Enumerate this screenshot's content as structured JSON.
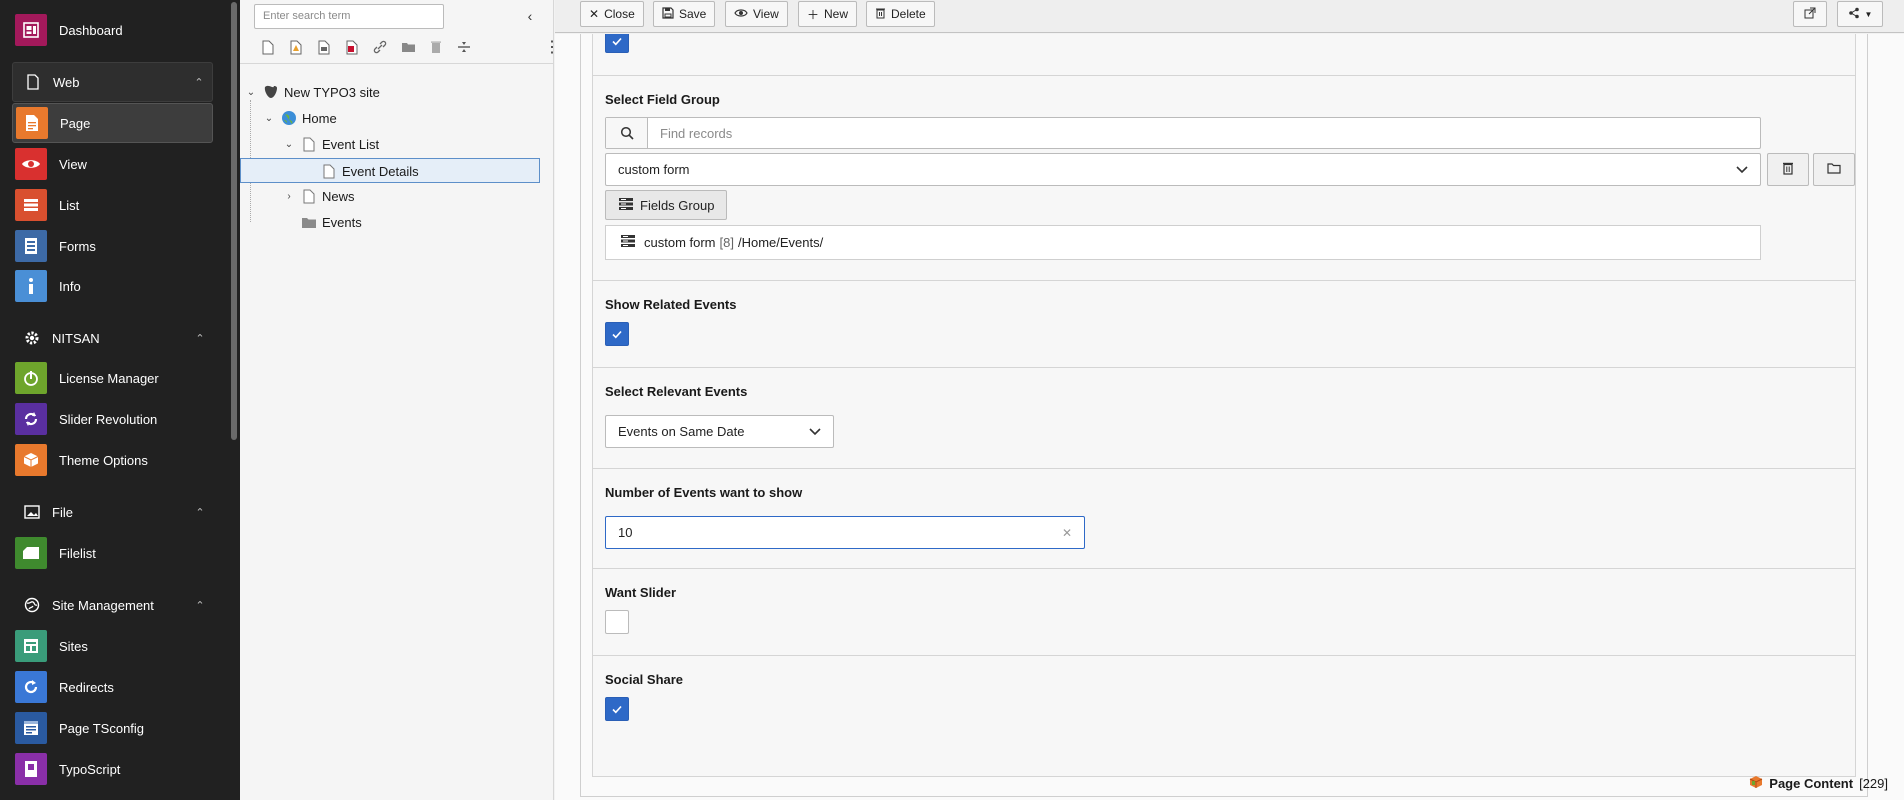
{
  "modules": {
    "dashboard": "Dashboard",
    "web": "Web",
    "page": "Page",
    "view": "View",
    "list": "List",
    "forms": "Forms",
    "info": "Info",
    "nitsan": "NITSAN",
    "license_manager": "License Manager",
    "slider_revolution": "Slider Revolution",
    "theme_options": "Theme Options",
    "file": "File",
    "filelist": "Filelist",
    "site_management": "Site Management",
    "sites": "Sites",
    "redirects": "Redirects",
    "page_tsconfig": "Page TSconfig",
    "typoscript": "TypoScript"
  },
  "tree": {
    "search_placeholder": "Enter search term",
    "nodes": {
      "root": "New TYPO3 site",
      "home": "Home",
      "event_list": "Event List",
      "event_details": "Event Details",
      "news": "News",
      "events": "Events"
    }
  },
  "toolbar": {
    "close": "Close",
    "save": "Save",
    "view": "View",
    "new": "New",
    "delete": "Delete"
  },
  "form": {
    "field_group_label": "Select Field Group",
    "find_placeholder": "Find records",
    "field_group_value": "custom form",
    "fields_group_button": "Fields Group",
    "record_title": "custom form",
    "record_id": "[8]",
    "record_path": "/Home/Events/",
    "show_related_label": "Show Related Events",
    "show_related_checked": true,
    "relevant_label": "Select Relevant Events",
    "relevant_value": "Events on Same Date",
    "number_label": "Number of Events want to show",
    "number_value": "10",
    "slider_label": "Want Slider",
    "slider_checked": false,
    "social_label": "Social Share",
    "social_checked": true
  },
  "footer": {
    "label": "Page Content",
    "count": "[229]"
  },
  "colors": {
    "sidebar_bg": "#212121",
    "accent_blue": "#2e69c7",
    "dashboard_icon": "#a3195b",
    "page_icon": "#e8792d",
    "view_icon": "#d9302f",
    "list_icon": "#d9502f",
    "forms_icon": "#3d6aa6",
    "info_icon": "#4a8fd6",
    "license_icon": "#6ea52c",
    "slider_icon": "#5a2fa0",
    "theme_icon": "#e8792d",
    "filelist_icon": "#3f8a2e",
    "sites_icon": "#3a9c7a",
    "redirects_icon": "#3a78d6",
    "tsconfig_icon": "#2a5aa0",
    "typoscript_icon": "#8a2fa8"
  }
}
